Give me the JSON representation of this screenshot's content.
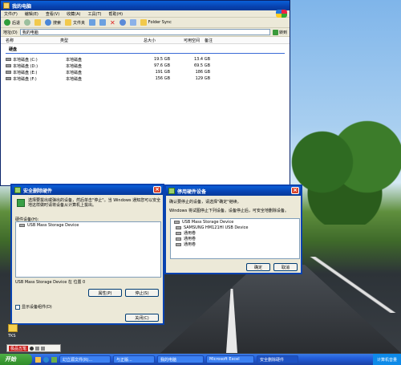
{
  "explorer": {
    "title": "我的电脑",
    "menu": [
      "文件(F)",
      "编辑(E)",
      "查看(V)",
      "收藏(A)",
      "工具(T)",
      "帮助(H)"
    ],
    "toolbar": {
      "back": "后退",
      "search": "搜索",
      "folders": "文件夹",
      "folder_sync": "Folder Sync"
    },
    "address_label": "地址(D)",
    "address_value": "我的电脑",
    "go_label": "转到",
    "columns": [
      "名称",
      "类型",
      "总大小",
      "可用空间",
      "备注"
    ],
    "group": "硬盘",
    "drives": [
      {
        "name": "本地磁盘 (C:)",
        "type": "本地磁盘",
        "total": "19.5 GB",
        "free": "13.4 GB"
      },
      {
        "name": "本地磁盘 (D:)",
        "type": "本地磁盘",
        "total": "97.6 GB",
        "free": "69.5 GB"
      },
      {
        "name": "本地磁盘 (E:)",
        "type": "本地磁盘",
        "total": "191 GB",
        "free": "186 GB"
      },
      {
        "name": "本地磁盘 (F:)",
        "type": "本地磁盘",
        "total": "156 GB",
        "free": "129 GB"
      }
    ]
  },
  "safe_remove": {
    "title": "安全删除硬件",
    "description": "选择要拔出或弹出的设备，然后单击\"停止\"。当 Windows 通知您可以安全地这样做时请将设备从计算机上拔出。",
    "list_label": "硬件设备(H):",
    "devices": [
      "USB Mass Storage Device"
    ],
    "status": "USB Mass Storage Device 在 位置 0",
    "properties_button": "属性(P)",
    "stop_button": "停止(S)",
    "show_components_label": "显示设备组件(D)",
    "close_button": "关闭(C)"
  },
  "stop_device": {
    "title": "停用硬件设备",
    "instruction": "确认要停止的设备，请选择\"确定\"继续。",
    "subtext": "Windows 将试图停止下列设备。设备停止后，可安全地删除设备。",
    "devices": [
      "USB Mass Storage Device",
      "SAMSUNG HM121HI USB Device",
      "通用卷",
      "通用卷",
      "通用卷"
    ],
    "ok_button": "确定",
    "cancel_button": "取消"
  },
  "desktop": {
    "icon_label": "TKS",
    "ime_label": "极品五笔"
  },
  "taskbar": {
    "start": "开始",
    "tasks": [
      "幻立源文件(R)...",
      "与正版...",
      "我的电脑",
      "Microsoft Excel",
      "安全删除硬件"
    ],
    "tray": "计算机音量"
  }
}
